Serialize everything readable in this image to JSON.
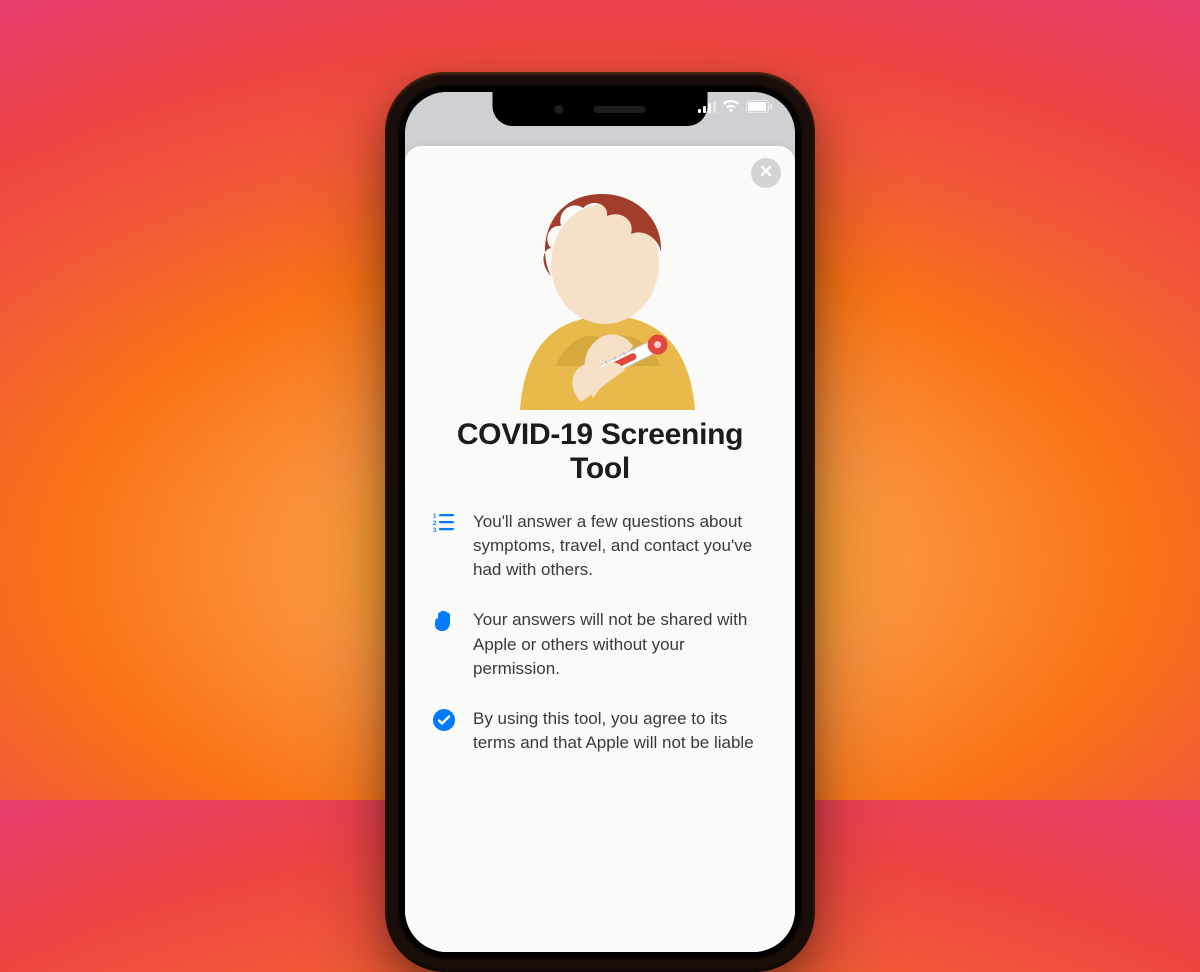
{
  "title": "COVID-19 Screening Tool",
  "bullets": [
    {
      "icon": "numbered-list-icon",
      "text": "You'll answer a few questions about symptoms, travel, and contact you've had with others."
    },
    {
      "icon": "hand-icon",
      "text": "Your answers will not be shared with Apple or others without your permission."
    },
    {
      "icon": "checkmark-circle-icon",
      "text": "By using this tool, you agree to its terms and that Apple will not be liable"
    }
  ],
  "status": {
    "signal": "signal-icon",
    "wifi": "wifi-icon",
    "battery": "battery-icon"
  },
  "close_label": "Close",
  "colors": {
    "accent": "#007aff",
    "hair": "#a13d2a",
    "shirt": "#e9b94b",
    "skin": "#f7e0c8",
    "therm_red": "#e3463a"
  }
}
